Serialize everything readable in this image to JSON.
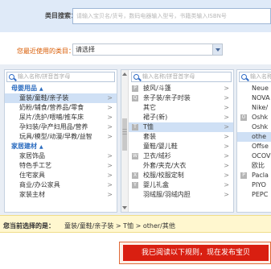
{
  "search": {
    "label": "类目搜索：",
    "placeholder": "请输入宝贝名/货号，数码电器输入型号，书籍类输入ISBN号"
  },
  "recent": {
    "label": "您最近使用的类目：",
    "value": "请选择"
  },
  "panel1": {
    "search_placeholder": "输入名称/拼音首字母",
    "groups": [
      {
        "label": "母婴用品",
        "items": [
          {
            "label": "童装/童鞋/亲子装",
            "selected": true
          },
          {
            "label": "奶粉/辅食/营养品/零食"
          },
          {
            "label": "尿片/洗护/喂哺/推车床"
          },
          {
            "label": "孕妇装/孕产妇用品/营养"
          },
          {
            "label": "玩具/模型/动漫/早教/益智"
          }
        ]
      },
      {
        "label": "家居建材",
        "items": [
          {
            "label": "家居饰品"
          },
          {
            "label": "特色手工艺"
          },
          {
            "label": "住宅家具"
          },
          {
            "label": "商业/办公家具"
          },
          {
            "label": "家装主材"
          }
        ]
      }
    ]
  },
  "panel2": {
    "search_placeholder": "输入名称/拼音首字母",
    "items": [
      {
        "letter": "P",
        "label": "披风/斗篷"
      },
      {
        "letter": "Q",
        "label": "亲子装/亲子时装"
      },
      {
        "letter": "",
        "label": "其它"
      },
      {
        "letter": "",
        "label": "裙子(新)"
      },
      {
        "letter": "T",
        "label": "T恤",
        "selected": true
      },
      {
        "letter": "",
        "label": "套装"
      },
      {
        "letter": "",
        "label": "童鞋/婴儿鞋"
      },
      {
        "letter": "W",
        "label": "卫衣/绒衫"
      },
      {
        "letter": "",
        "label": "外套/夹克/大衣"
      },
      {
        "letter": "X",
        "label": "校服/校服定制"
      },
      {
        "letter": "Y",
        "label": "婴儿礼盒"
      },
      {
        "letter": "",
        "label": "羽绒服/羽绒内胆"
      }
    ]
  },
  "panel3": {
    "search_placeholder": "输入名称/",
    "items": [
      {
        "letter": "",
        "label": "Neue"
      },
      {
        "letter": "",
        "label": "NOVA"
      },
      {
        "letter": "",
        "label": "Nike/"
      },
      {
        "letter": "O",
        "label": "Oshk"
      },
      {
        "letter": "",
        "label": "Oshk"
      },
      {
        "letter": "",
        "label": "othe",
        "selected": true
      },
      {
        "letter": "",
        "label": "Offse"
      },
      {
        "letter": "",
        "label": "OCOV"
      },
      {
        "letter": "",
        "label": "欧比"
      },
      {
        "letter": "P",
        "label": "Pacla"
      },
      {
        "letter": "",
        "label": "PIYO"
      },
      {
        "letter": "",
        "label": "PEPC"
      }
    ]
  },
  "current": {
    "label": "您当前选择的是：",
    "path": "童装/童鞋/亲子装 > T恤 > other/其他"
  },
  "publish_button": "我已阅读以下规则，现在发布宝贝",
  "colors": {
    "accent": "#d91f11",
    "link": "#2a6bbf",
    "recent_label": "#d85a00",
    "band": "#dfeaf8"
  }
}
